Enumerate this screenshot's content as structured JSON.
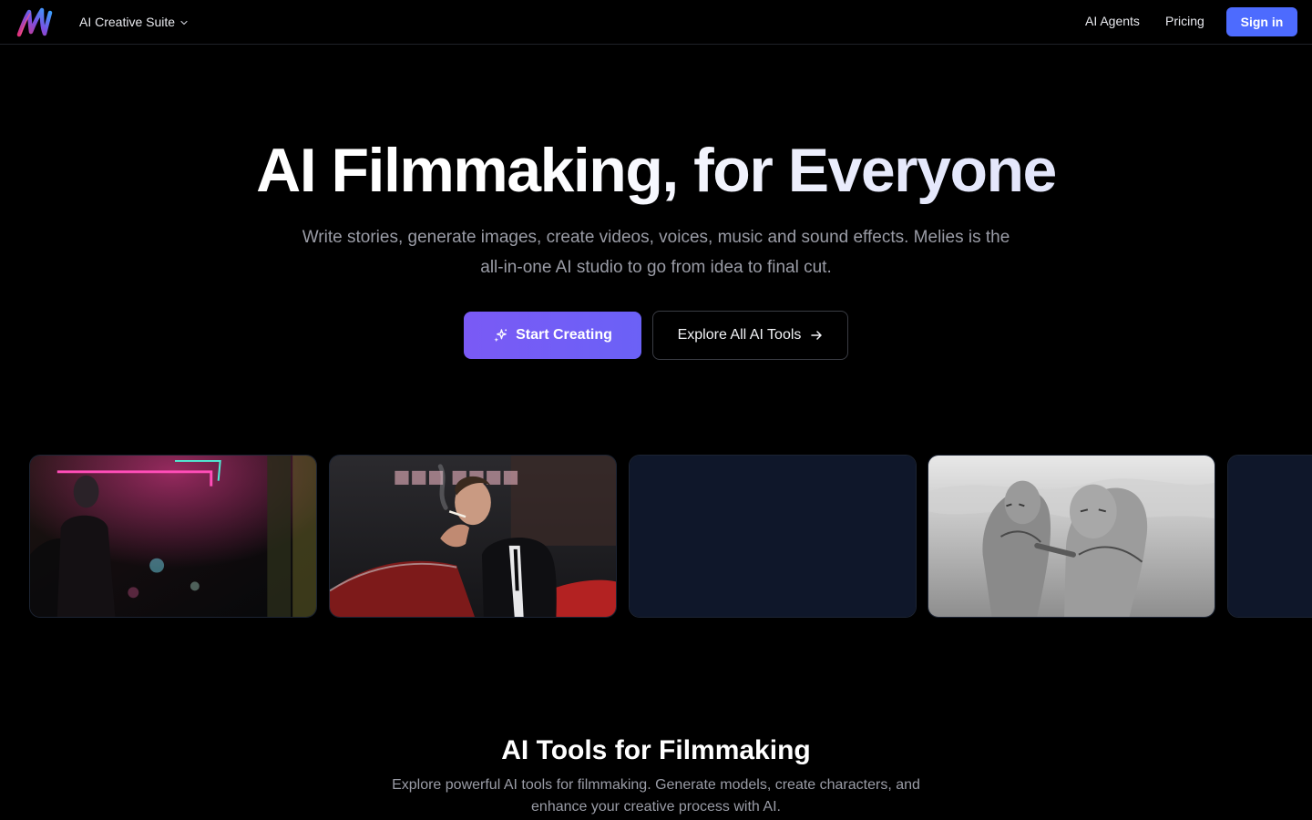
{
  "header": {
    "logo_icon": "melies-logo",
    "suite_label": "AI Creative Suite",
    "nav": [
      {
        "label": "AI Agents"
      },
      {
        "label": "Pricing"
      }
    ],
    "signin_label": "Sign in"
  },
  "hero": {
    "title": "AI Filmmaking, for Everyone",
    "subtitle": "Write stories, generate images, create videos, voices, music and sound effects. Melies is the all-in-one AI studio to go from idea to final cut.",
    "primary_cta": "Start Creating",
    "primary_cta_icon": "sparkles-icon",
    "secondary_cta": "Explore All AI Tools",
    "secondary_cta_icon": "arrow-right-icon"
  },
  "gallery": {
    "items": [
      {
        "id": "neon-street-scene"
      },
      {
        "id": "man-smoking-by-car"
      },
      {
        "id": "loading-placeholder"
      },
      {
        "id": "sketch-fighters"
      },
      {
        "id": "loading-placeholder"
      }
    ]
  },
  "tools_section": {
    "title": "AI Tools for Filmmaking",
    "subtitle": "Explore powerful AI tools for filmmaking. Generate models, create characters, and enhance your creative process with AI."
  },
  "colors": {
    "background": "#000000",
    "accent": "#4d6bfe",
    "primary_gradient_start": "#7a5af5",
    "primary_gradient_end": "#6b61f6",
    "muted_text": "#9a9ca6",
    "placeholder": "#0f172a"
  }
}
